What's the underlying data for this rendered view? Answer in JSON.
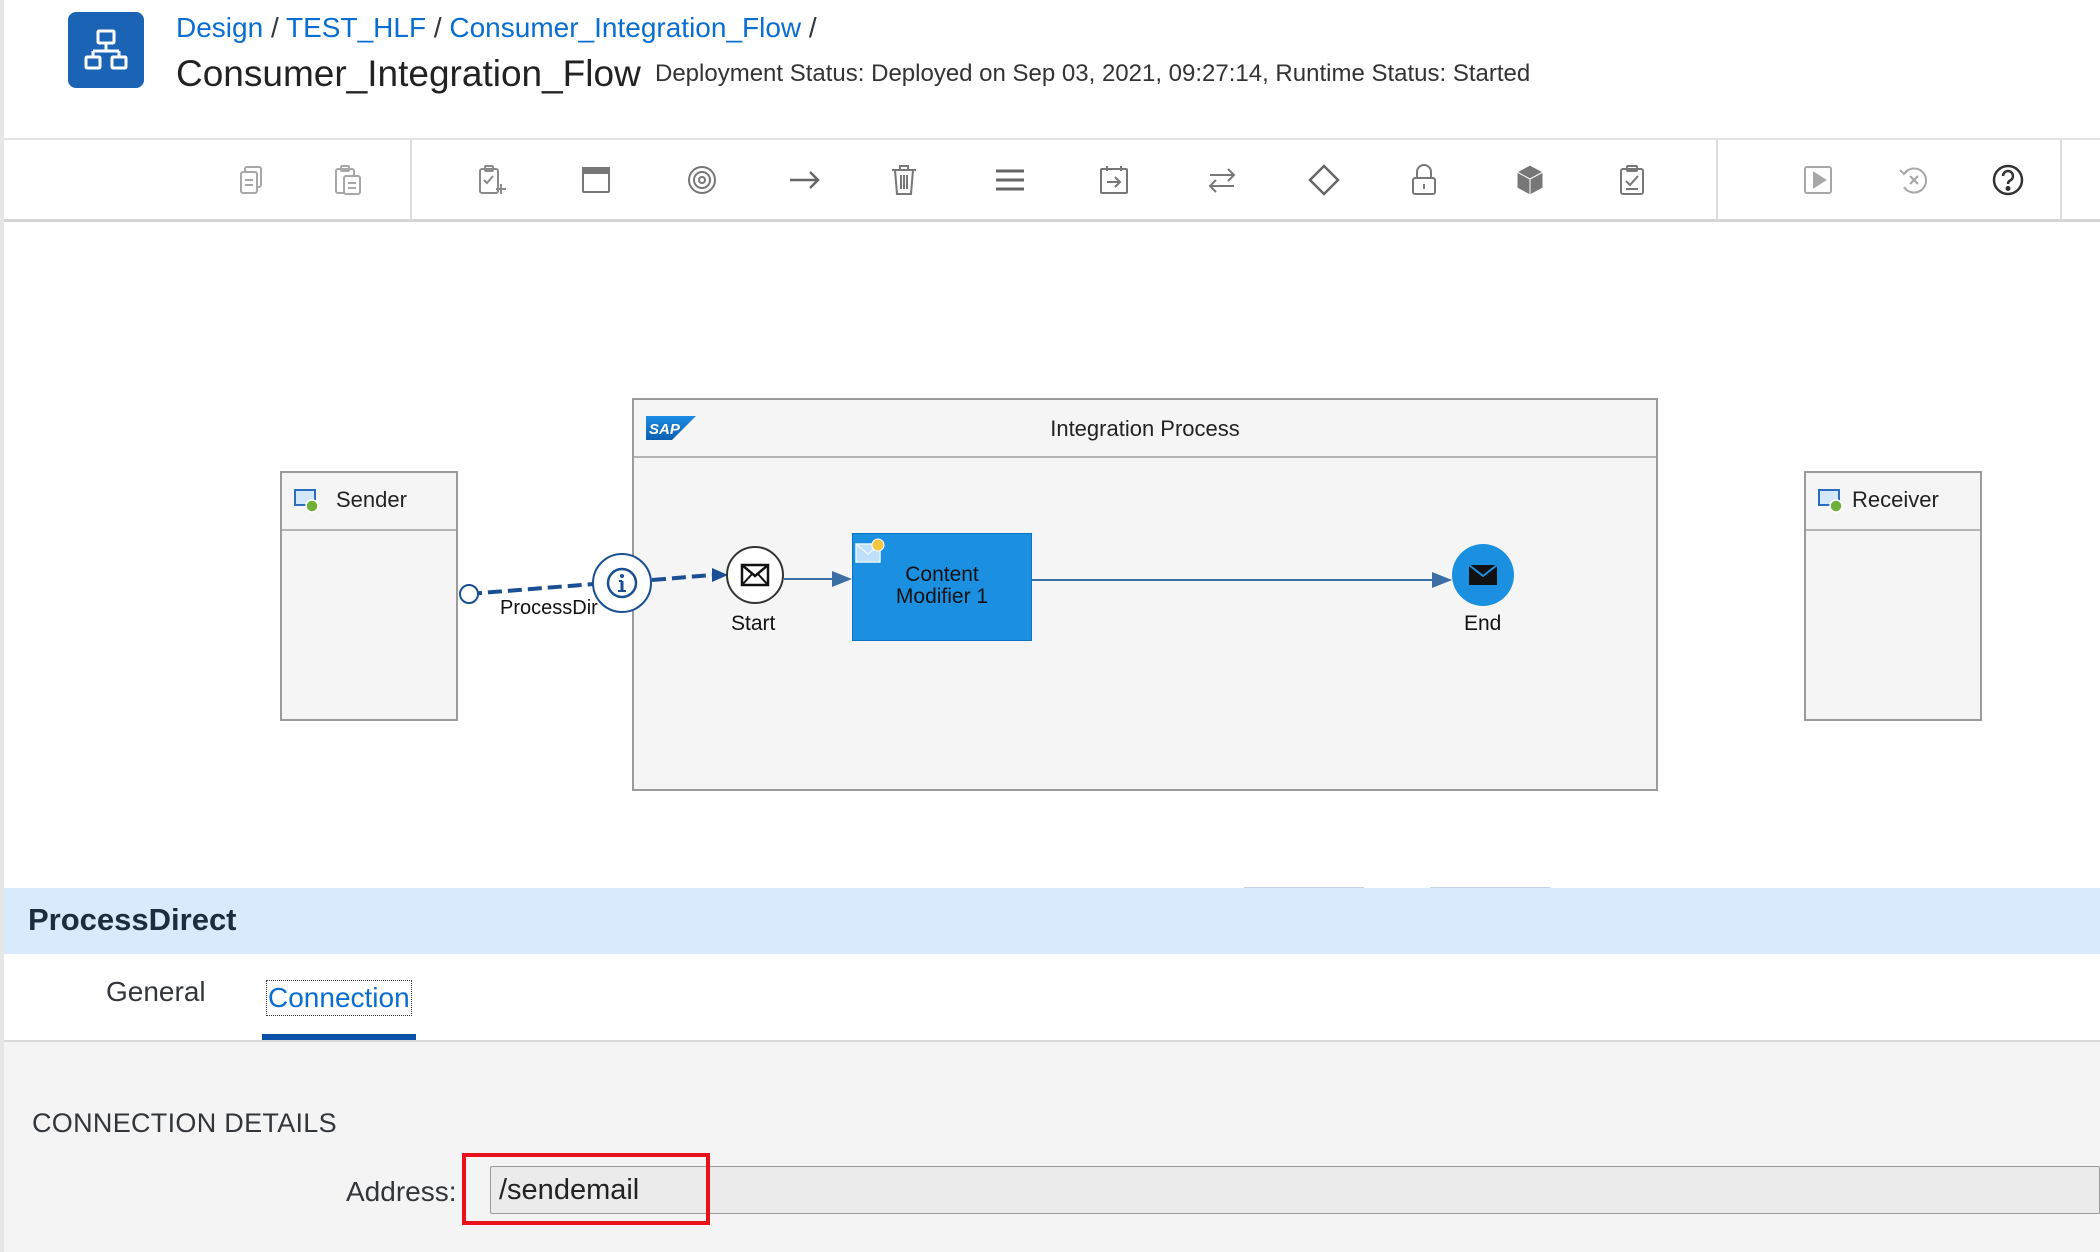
{
  "breadcrumb": {
    "items": [
      "Design",
      "TEST_HLF",
      "Consumer_Integration_Flow"
    ],
    "separator": "/"
  },
  "header": {
    "title": "Consumer_Integration_Flow",
    "deployment_status": "Deployment Status: Deployed on Sep 03, 2021, 09:27:14, Runtime Status: Started"
  },
  "toolbar": {
    "icons": [
      "copy-icon",
      "paste-icon",
      "add-to-clipboard-icon",
      "window-icon",
      "target-icon",
      "arrow-right-icon",
      "delete-icon",
      "menu-icon",
      "import-icon",
      "swap-icon",
      "diamond-icon",
      "lock-icon",
      "cube-icon",
      "checklist-icon",
      "simulate-icon",
      "reset-icon",
      "help-icon"
    ]
  },
  "diagram": {
    "sender_label": "Sender",
    "receiver_label": "Receiver",
    "integration_process_label": "Integration Process",
    "sap_logo_text": "SAP",
    "start_label": "Start",
    "end_label": "End",
    "content_modifier_label_line1": "Content",
    "content_modifier_label_line2": "Modifier 1",
    "connection_label": "ProcessDir"
  },
  "properties": {
    "title": "ProcessDirect",
    "tabs": [
      {
        "label": "General",
        "selected": false
      },
      {
        "label": "Connection",
        "selected": true
      }
    ],
    "section_heading": "CONNECTION DETAILS",
    "address_label": "Address:",
    "address_value": "/sendemail"
  },
  "colors": {
    "accent": "#0a6ed1",
    "app_icon": "#1b63b5",
    "panel_header": "#d8eafb",
    "step_fill": "#1b90e0",
    "highlight": "#e8101a"
  }
}
